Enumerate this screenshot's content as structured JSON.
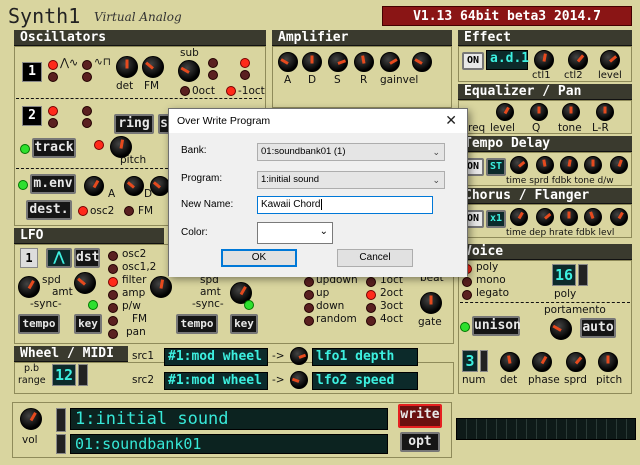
{
  "header": {
    "title": "Synth1",
    "subtitle": "Virtual Analog",
    "version": "V1.13 64bit beta3 2014.7"
  },
  "sections": {
    "oscillators": "Oscillators",
    "amplifier": "Amplifier",
    "effect": "Effect",
    "equalizer": "Equalizer / Pan",
    "tempo_delay": "Tempo Delay",
    "chorus": "Chorus / Flanger",
    "lfo": "LFO",
    "voice": "Voice",
    "wheel": "Wheel / MIDI"
  },
  "osc": {
    "one": "1",
    "two": "2",
    "det": "det",
    "fm": "FM",
    "sub": "sub",
    "oct0": "0oct",
    "oct1": "-1oct",
    "ring": "ring",
    "sync_initial": "s",
    "track": "track",
    "pitch": "pitch",
    "menv": "m.env",
    "dest": "dest.",
    "osc2": "osc2",
    "fm2": "FM",
    "a": "A",
    "d": "D"
  },
  "amp": {
    "a": "A",
    "d": "D",
    "s": "S",
    "r": "R",
    "gainvel": "gainvel"
  },
  "effect": {
    "on": "ON",
    "name": "a.d.1",
    "ctl1": "ctl1",
    "ctl2": "ctl2",
    "level": "level"
  },
  "eq": {
    "freq": "req",
    "level": "level",
    "q": "Q",
    "tone": "tone",
    "lr": "L-R"
  },
  "delay": {
    "on": "ON",
    "st": "ST",
    "labels": "time sprd fdbk tone d/w"
  },
  "chorus": {
    "on": "ON",
    "x1": "x1",
    "labels": "time dep hrate fdbk levl"
  },
  "lfo": {
    "one": "1",
    "dst": "dst",
    "dest_list": [
      "osc2",
      "osc1,2",
      "filter",
      "amp",
      "p/w",
      "FM",
      "pan"
    ],
    "spd": "spd",
    "amt": "amt",
    "sync": "-sync-",
    "tempo": "tempo",
    "key": "key",
    "modes": [
      "updown",
      "up",
      "down",
      "random"
    ],
    "octs": [
      "1oct",
      "2oct",
      "3oct",
      "4oct"
    ],
    "beat": "beat",
    "gate": "gate"
  },
  "voice": {
    "modes": [
      "poly",
      "mono",
      "legato"
    ],
    "count": "16",
    "poly": "poly",
    "portamento": "portamento",
    "auto": "auto",
    "unison": "unison",
    "num": "3",
    "num_label": "num",
    "det": "det",
    "phase": "phase",
    "sprd": "sprd",
    "pitch": "pitch"
  },
  "wheel": {
    "pb": "p.b",
    "range": "range",
    "range_value": "12",
    "src1": "src1",
    "src1_value": "#1:mod wheel",
    "dst1": "lfo1 depth",
    "src2": "src2",
    "src2_value": "#1:mod wheel",
    "dst2": "lfo2 speed"
  },
  "bottom": {
    "vol": "vol",
    "program": "1:initial sound",
    "bank": "01:soundbank01",
    "write": "write",
    "opt": "opt"
  },
  "dialog": {
    "title": "Over Write Program",
    "bank_label": "Bank:",
    "bank_value": "01:soundbank01 (1)",
    "program_label": "Program:",
    "program_value": "1:initial sound",
    "name_label": "New Name:",
    "name_value": "Kawaii Chord",
    "color_label": "Color:",
    "ok": "OK",
    "cancel": "Cancel"
  }
}
